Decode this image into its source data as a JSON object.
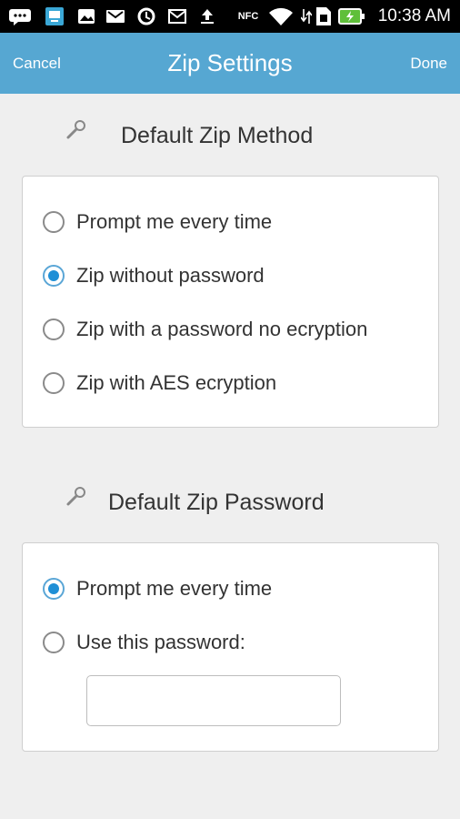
{
  "status_bar": {
    "time": "10:38 AM",
    "icons": [
      "chat-icon",
      "screen-icon",
      "image-icon",
      "gmail-icon",
      "sync-icon",
      "mail-icon",
      "upload-icon",
      "nfc-icon",
      "wifi-icon",
      "sim-icon",
      "battery-charging-icon"
    ],
    "nfc_label": "NFC"
  },
  "nav": {
    "cancel_label": "Cancel",
    "title": "Zip Settings",
    "done_label": "Done"
  },
  "method_section": {
    "title": "Default Zip Method",
    "options": [
      {
        "label": "Prompt me every time",
        "checked": false
      },
      {
        "label": "Zip without password",
        "checked": true
      },
      {
        "label": "Zip with a password no ecryption",
        "checked": false
      },
      {
        "label": "Zip with AES ecryption",
        "checked": false
      }
    ]
  },
  "password_section": {
    "title": "Default Zip Password",
    "options": [
      {
        "label": "Prompt me every time",
        "checked": true
      },
      {
        "label": "Use this password:",
        "checked": false
      }
    ],
    "password_value": "",
    "password_placeholder": ""
  },
  "colors": {
    "nav_background": "#56a7d2",
    "radio_checked": "#1f8fd6",
    "page_background": "#efefef"
  }
}
